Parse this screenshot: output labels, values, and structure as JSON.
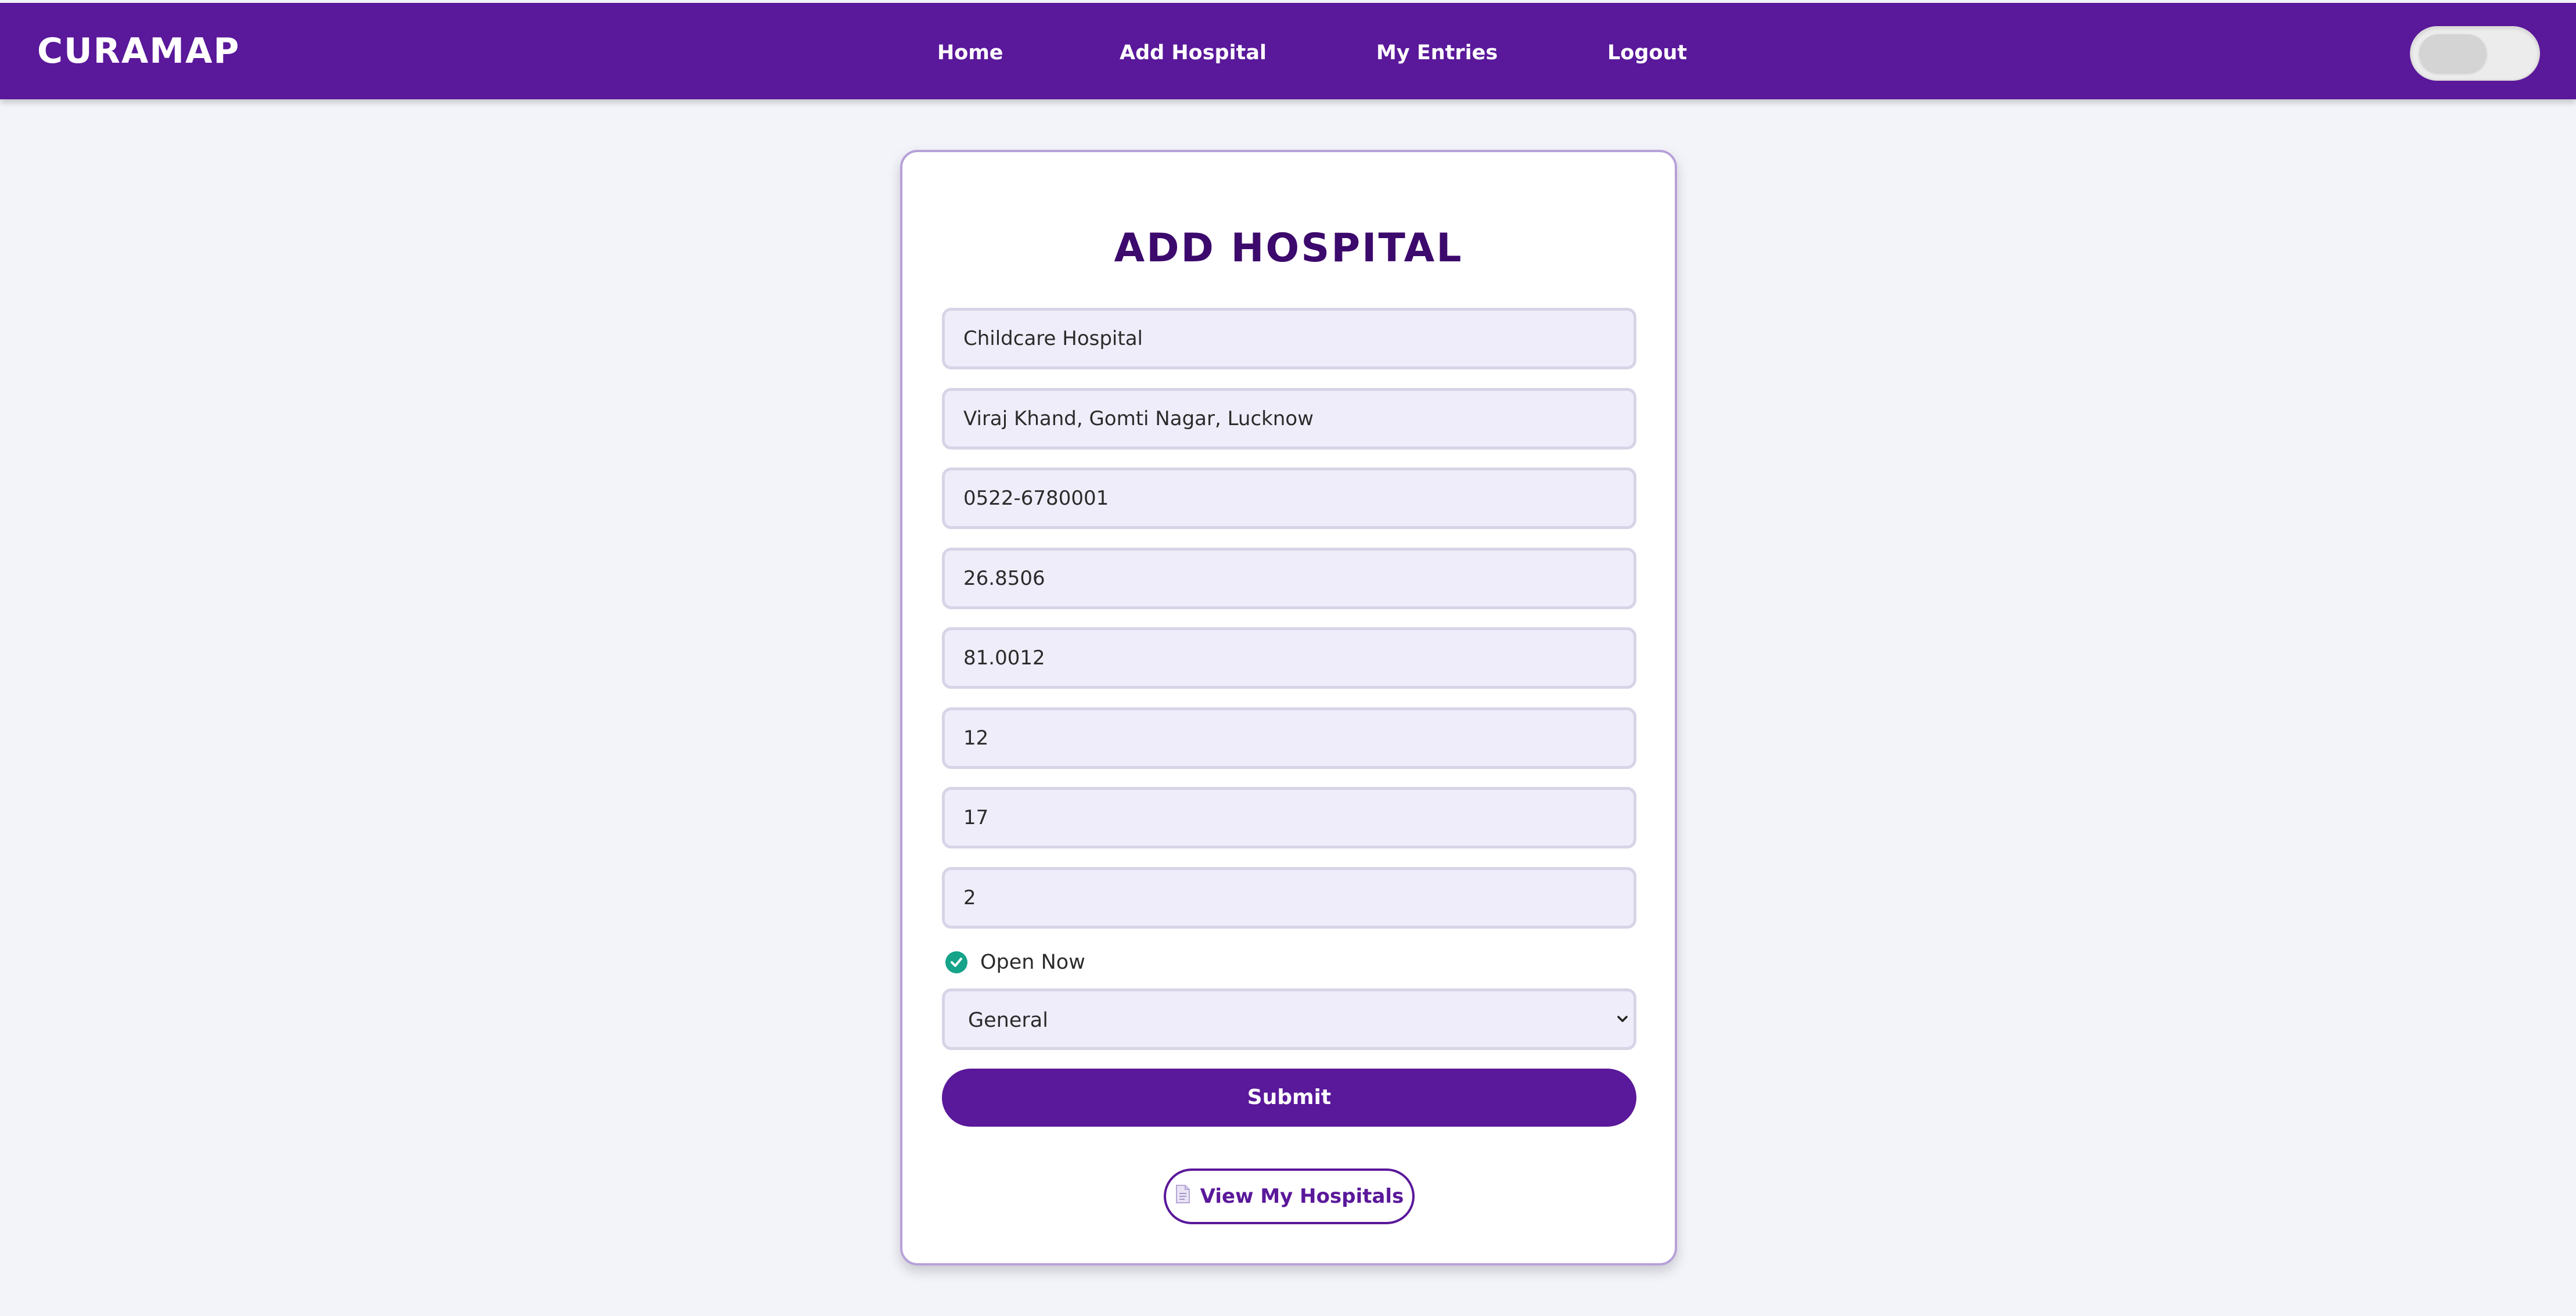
{
  "brand": "CURAMAP",
  "nav": {
    "home": "Home",
    "add_hospital": "Add Hospital",
    "my_entries": "My Entries",
    "logout": "Logout"
  },
  "theme_toggle": {
    "icon": "toggle-switch",
    "state": "off"
  },
  "form": {
    "title": "ADD HOSPITAL",
    "fields": {
      "name": "Childcare Hospital",
      "address": "Viraj Khand, Gomti Nagar, Lucknow",
      "phone": "0522-6780001",
      "latitude": "26.8506",
      "longitude": "81.0012",
      "field6": "12",
      "field7": "17",
      "field8": "2"
    },
    "open_now": {
      "label": "Open Now",
      "checked": true
    },
    "type_select": {
      "value": "General"
    },
    "submit_label": "Submit",
    "view_my_hospitals_label": "View My Hospitals"
  },
  "colors": {
    "primary": "#5a189a",
    "title": "#3c096c",
    "check": "#15a38a",
    "background": "#f3f4fa",
    "field_bg": "#efedfa"
  }
}
